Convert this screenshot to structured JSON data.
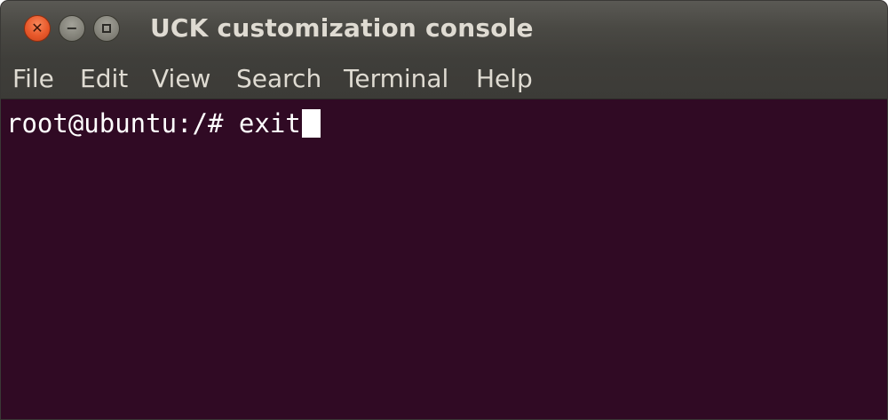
{
  "window": {
    "title": "UCK customization console"
  },
  "window_controls": {
    "close_icon": "close-icon",
    "minimize_icon": "minimize-icon",
    "maximize_icon": "maximize-icon"
  },
  "menu": {
    "items": [
      "File",
      "Edit",
      "View",
      "Search",
      "Terminal",
      "Help"
    ]
  },
  "terminal": {
    "prompt": "root@ubuntu:/# ",
    "command": "exit"
  },
  "colors": {
    "terminal_background": "#300a24",
    "terminal_text": "#ffffff",
    "titlebar": "#4a4944",
    "menubar": "#3c3b37",
    "close_button": "#e8582a"
  }
}
